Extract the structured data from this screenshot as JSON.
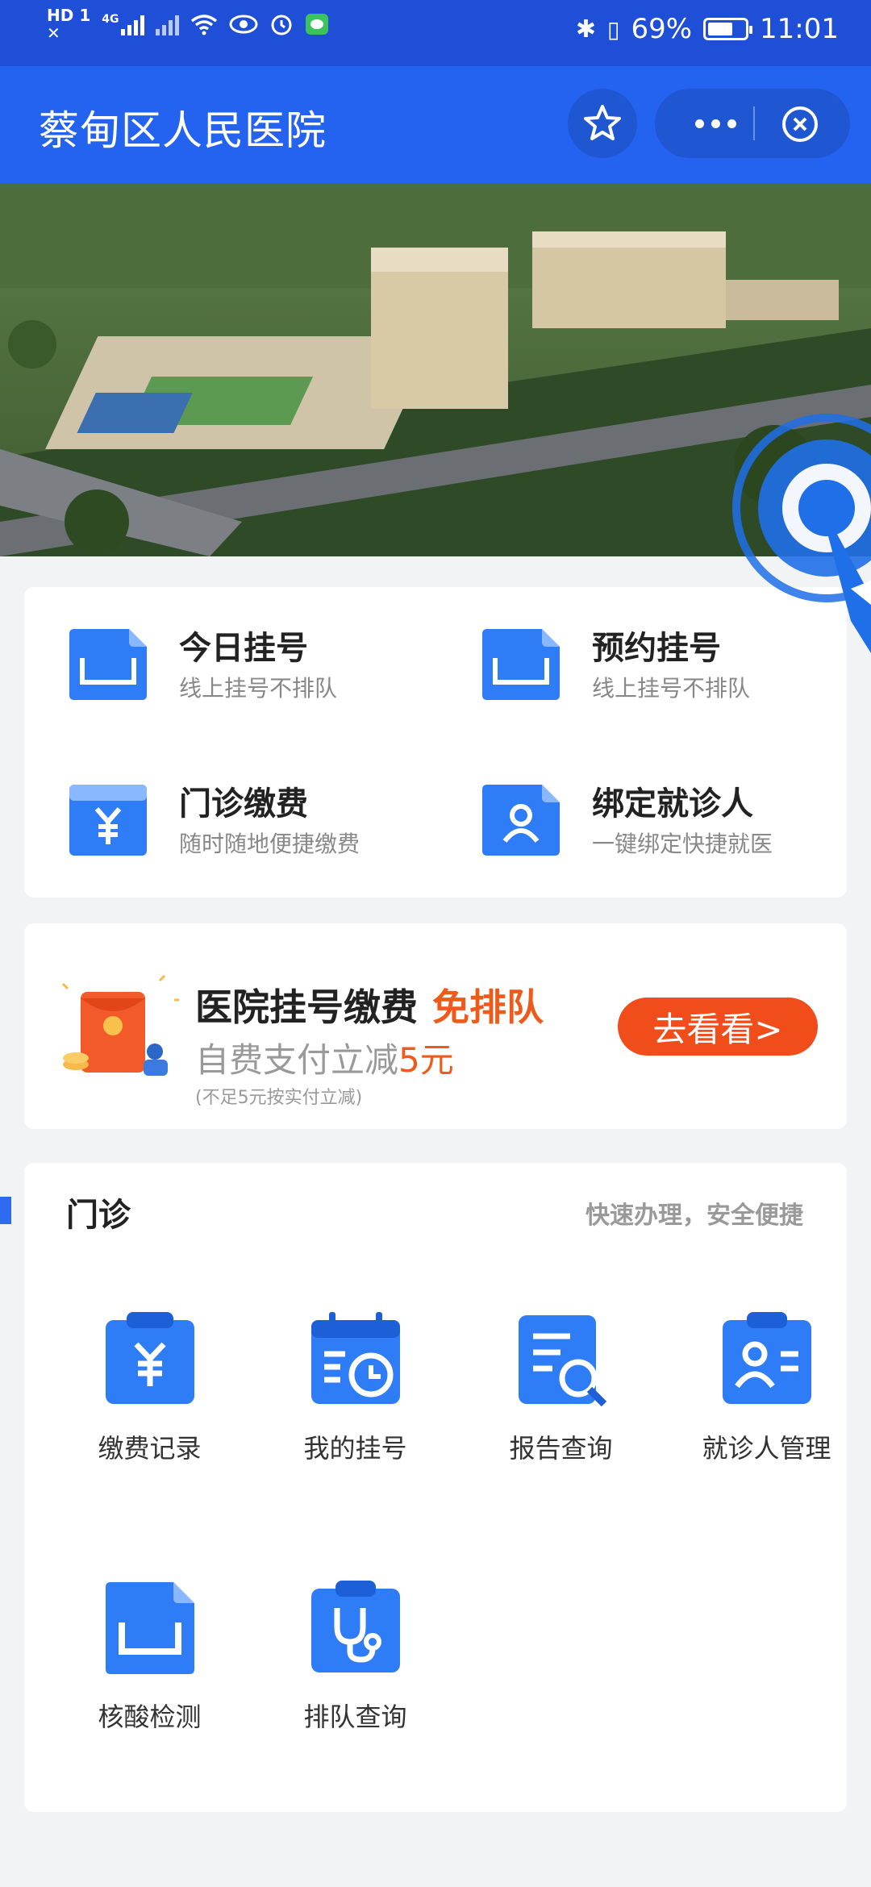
{
  "status_bar": {
    "network_left_top": "HD",
    "network_left_badge": "1",
    "signal_label": "4G",
    "battery_percent": "69%",
    "time": "11:01"
  },
  "nav": {
    "title": "蔡甸区人民医院"
  },
  "quick_actions": [
    {
      "title": "今日挂号",
      "subtitle": "线上挂号不排队",
      "icon": "bed-icon"
    },
    {
      "title": "预约挂号",
      "subtitle": "线上挂号不排队",
      "icon": "bed-icon"
    },
    {
      "title": "门诊缴费",
      "subtitle": "随时随地便捷缴费",
      "icon": "yuan-icon"
    },
    {
      "title": "绑定就诊人",
      "subtitle": "一键绑定快捷就医",
      "icon": "person-icon"
    }
  ],
  "promo": {
    "title": "医院挂号缴费",
    "accent": "免排队",
    "sub_prefix": "自费支付立减",
    "sub_amount": "5元",
    "note": "(不足5元按实付立减)",
    "button": "去看看>"
  },
  "clinic": {
    "title": "门诊",
    "hint": "快速办理，安全便捷",
    "services": [
      {
        "label": "缴费记录",
        "icon": "payment-record-icon"
      },
      {
        "label": "我的挂号",
        "icon": "calendar-clock-icon"
      },
      {
        "label": "报告查询",
        "icon": "report-search-icon"
      },
      {
        "label": "就诊人管理",
        "icon": "patient-card-icon"
      },
      {
        "label": "核酸检测",
        "icon": "bed-icon"
      },
      {
        "label": "排队查询",
        "icon": "stethoscope-icon"
      }
    ]
  },
  "colors": {
    "status_bar": "#1f4fd6",
    "nav_bar": "#2462f0",
    "icon_blue": "#2f7df6",
    "accent_orange": "#ee5a1a"
  }
}
